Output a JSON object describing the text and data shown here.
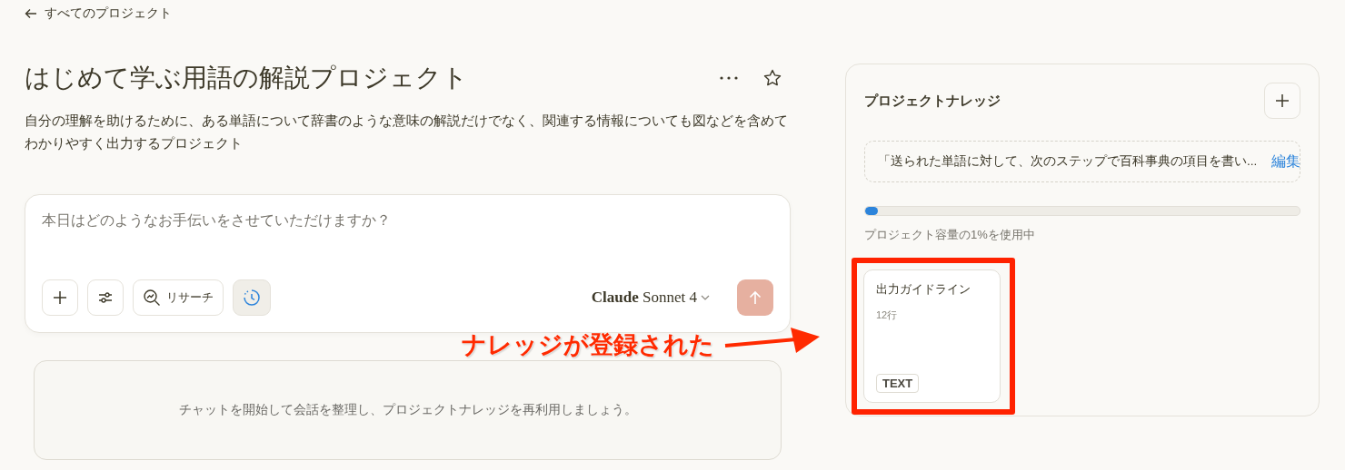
{
  "back_link": {
    "label": "すべてのプロジェクト"
  },
  "project": {
    "title": "はじめて学ぶ用語の解説プロジェクト",
    "description": "自分の理解を助けるために、ある単語について辞書のような意味の解説だけでなく、関連する情報についても図などを含めてわかりやすく出力するプロジェクト",
    "starred": false
  },
  "composer": {
    "placeholder": "本日はどのようなお手伝いをさせていただけますか？",
    "tools": [
      {
        "kind": "add",
        "selected": false
      },
      {
        "kind": "settings",
        "selected": false
      },
      {
        "kind": "research",
        "label": "リサーチ",
        "selected": false
      },
      {
        "kind": "history",
        "selected": true
      }
    ],
    "model": "**Claude** Sonnet 4",
    "send_disabled": true
  },
  "empty_state": "チャットを開始して会話を整理し、プロジェクトナレッジを再利用しましょう。",
  "knowledge": {
    "title": "プロジェクトナレッジ",
    "instructions": "「送られた単語に対して、次のステップで百科事典の項目を書い...",
    "edit_link": "編集",
    "level": 0.01,
    "usage_label": "プロジェクト容量の1%を使用中",
    "files": [
      {
        "name": "出力ガイドライン",
        "lines": "12行",
        "type": "TEXT",
        "highlighted": true
      }
    ]
  },
  "annotation": {
    "label": "ナレッジが登録された"
  }
}
